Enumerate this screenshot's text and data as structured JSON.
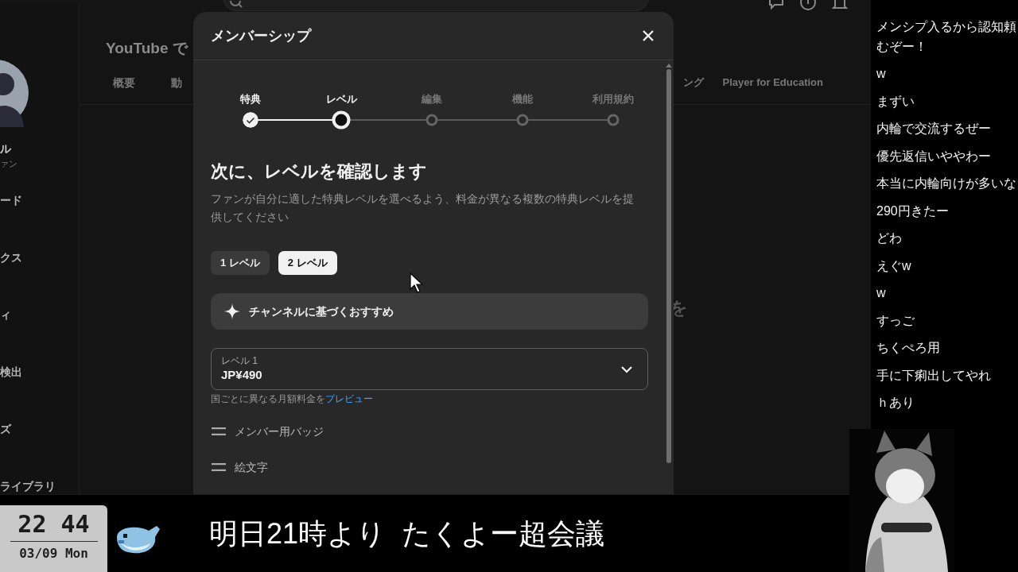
{
  "sidebar": {
    "channel_name": "ル",
    "channel_subtitle": "ァン",
    "items": [
      {
        "label": "ード"
      },
      {
        "label": "クス"
      },
      {
        "label": "ィ"
      },
      {
        "label": "検出"
      },
      {
        "label": "ズ"
      },
      {
        "label": "ライブラリ"
      }
    ]
  },
  "studio": {
    "page_title": "YouTube で",
    "tabs": [
      {
        "label": "概要"
      },
      {
        "label": "動"
      },
      {
        "label": "ング"
      },
      {
        "label": "Player for Education"
      }
    ],
    "background_glyph": "を"
  },
  "dialog": {
    "title": "メンバーシップ",
    "steps": [
      {
        "label": "特典",
        "completed": true,
        "selected": false
      },
      {
        "label": "レベル",
        "completed": false,
        "selected": true
      },
      {
        "label": "編集",
        "completed": false,
        "selected": false
      },
      {
        "label": "機能",
        "completed": false,
        "selected": false
      },
      {
        "label": "利用規約",
        "completed": false,
        "selected": false
      }
    ],
    "heading": "次に、レベルを確認します",
    "description": "ファンが自分に適した特典レベルを選べるよう、料金が異なる複数の特典レベルを提供してください",
    "level_options": [
      {
        "label": "1 レベル",
        "selected": false
      },
      {
        "label": "2 レベル",
        "selected": true
      }
    ],
    "recommendation": "チャンネルに基づくおすすめ",
    "price_select": {
      "label": "レベル 1",
      "value": "JP¥490"
    },
    "price_note": "国ごとに異なる月額料金を",
    "price_note_link": "プレビュー",
    "perks": [
      "メンバー用バッジ",
      "絵文字"
    ]
  },
  "chat": {
    "messages": [
      "メンシプ入るから認知頼むぞー！",
      "w",
      "まずい",
      "内輪で交流するぜー",
      "優先返信いややわー",
      "本当に内輪向けが多いな",
      "290円きたー",
      "どわ",
      "えぐw",
      "w",
      "すっご",
      "ちくぺろ用",
      "手に下痢出してやれ",
      "ｈあり"
    ]
  },
  "ticker": {
    "clock": {
      "time": "22 44",
      "date": "03/09 Mon"
    },
    "text": "明日21時より  たくよー超会議"
  }
}
